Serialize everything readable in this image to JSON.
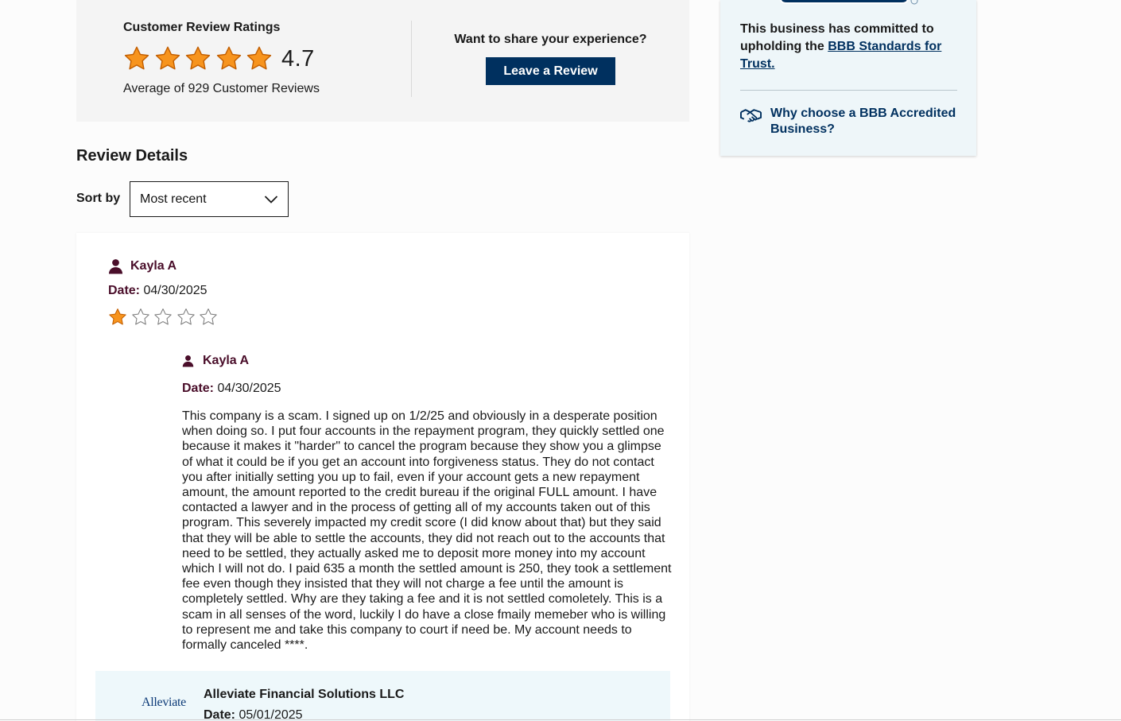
{
  "summary": {
    "title": "Customer Review Ratings",
    "average": "4.7",
    "count_text": "Average of 929 Customer Reviews",
    "share_prompt": "Want to share your experience?",
    "leave_review_label": "Leave a Review",
    "stars_filled": 5
  },
  "details": {
    "title": "Review Details",
    "sort_label": "Sort by",
    "sort_value": "Most recent"
  },
  "review": {
    "reviewer": "Kayla A",
    "date_label": "Date:",
    "date": "04/30/2025",
    "rating": 1,
    "rating_max": 5,
    "inner_reviewer": "Kayla A",
    "inner_date_label": "Date:",
    "inner_date": "04/30/2025",
    "text": "This company is a scam. I signed up on 1/2/25 and obviously in a desperate position when doing so. I put four accounts in the repayment program, they quickly settled one because it makes it \"harder\" to cancel the program because they show you a glimpse of what it could be if you get an account into forgiveness status. They do not contact you after initially setting you up to fail, even if your account gets a new repayment amount, the amount reported to the credit bureau if the original FULL amount. I have contacted a lawyer and in the process of getting all of my accounts taken out of this program. This severely impacted my credit score (I did know about that) but they said that they will be able to settle the accounts, they did not reach out to the accounts that need to be settled, they actually asked me to deposit more money into my account which I will not do. I paid 635 a month the settled amount is 250, they took a settlement fee even though they insisted that they will not charge a fee until the amount is completely settled. Why are they taking a fee and it is not settled comoletely. This is a scam in all senses of the word, luckily I do have a close fmaily memeber who is willing to represent me and take this company to court if need be. My account needs to formally canceled ****.",
    "response": {
      "logo_text": "Alleviate",
      "business": "Alleviate Financial Solutions LLC",
      "date_label": "Date:",
      "date": "05/01/2025"
    }
  },
  "sidebar": {
    "commit_text": "This business has committed to upholding the",
    "standards_link": "BBB Standards for Trust.",
    "why_link": "Why choose a BBB Accredited Business?"
  },
  "colors": {
    "star_fill": "#f7941e",
    "star_stroke": "#c25e00",
    "primary": "#00305f",
    "reviewer_name": "#4a0e2a",
    "response_bg": "#eef8fb"
  }
}
